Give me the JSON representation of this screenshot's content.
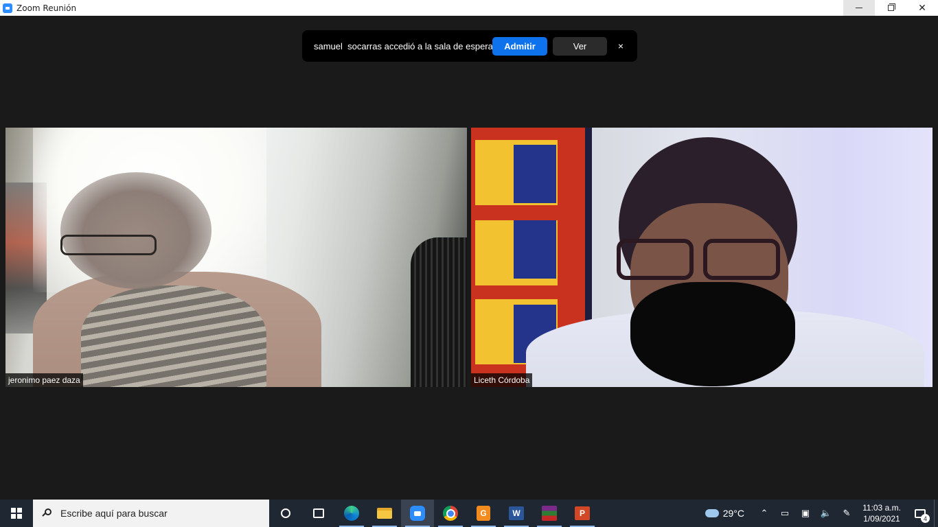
{
  "window": {
    "title": "Zoom Reunión"
  },
  "notification": {
    "message": "samuel  socarras accedió a la sala de espera",
    "admit_label": "Admitir",
    "view_label": "Ver",
    "close_label": "×"
  },
  "participants": [
    {
      "name": "jeronimo paez daza"
    },
    {
      "name": "Liceth Córdoba"
    }
  ],
  "taskbar": {
    "search_placeholder": "Escribe aquí para buscar",
    "apps": [
      "cortana-icon",
      "task-view-icon",
      "edge-icon",
      "file-explorer-icon",
      "zoom-icon",
      "chrome-icon",
      "pdf-app-icon",
      "word-icon",
      "winrar-icon",
      "powerpoint-icon"
    ],
    "pdf_label": "G",
    "word_label": "W",
    "ppt_label": "P"
  },
  "tray": {
    "temperature": "29°C",
    "time": "11:03 a.m.",
    "date": "1/09/2021",
    "notification_count": "4"
  },
  "colors": {
    "admit": "#0e72ed",
    "taskbar": "#1f2733",
    "background": "#1a1a1a"
  }
}
